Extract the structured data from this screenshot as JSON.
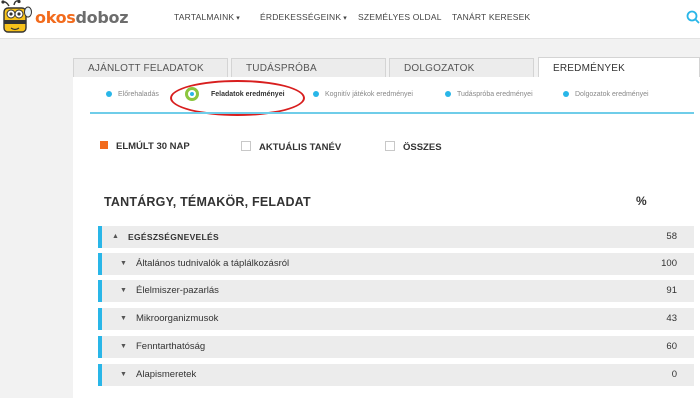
{
  "brand": {
    "logo_part1": "okos",
    "logo_part2": "doboz"
  },
  "nav": {
    "items": [
      {
        "label": "TARTALMAINK",
        "dropdown": true
      },
      {
        "label": "ÉRDEKESSÉGEINK",
        "dropdown": true
      },
      {
        "label": "SZEMÉLYES OLDAL",
        "dropdown": false
      },
      {
        "label": "TANÁRT KERESEK",
        "dropdown": false
      }
    ],
    "caret": "▾",
    "search_icon": "search-icon"
  },
  "tabs": [
    {
      "label": "AJÁNLOTT FELADATOK",
      "active": false
    },
    {
      "label": "TUDÁSPRÓBA",
      "active": false
    },
    {
      "label": "DOLGOZATOK",
      "active": false
    },
    {
      "label": "EREDMÉNYEK",
      "active": true
    }
  ],
  "subtabs": [
    {
      "label": "Előrehaladás",
      "active": false
    },
    {
      "label": "Feladatok eredményei",
      "active": true
    },
    {
      "label": "Kognitív játékok eredményei",
      "active": false
    },
    {
      "label": "Tudáspróba eredményei",
      "active": false
    },
    {
      "label": "Dolgozatok eredményei",
      "active": false
    }
  ],
  "filters": [
    {
      "label": "ELMÚLT 30 NAP",
      "checked": true
    },
    {
      "label": "AKTUÁLIS TANÉV",
      "checked": false
    },
    {
      "label": "ÖSSZES",
      "checked": false
    }
  ],
  "table": {
    "header_title": "TANTÁRGY, TÉMAKÖR, FELADAT",
    "header_pct": "%",
    "parent": {
      "name": "EGÉSZSÉGNEVELÉS",
      "value": "58",
      "arrow": "▲"
    },
    "rows": [
      {
        "name": "Általános tudnivalók a táplálkozásról",
        "value": "100",
        "arrow": "▼"
      },
      {
        "name": "Élelmiszer-pazarlás",
        "value": "91",
        "arrow": "▼"
      },
      {
        "name": "Mikroorganizmusok",
        "value": "43",
        "arrow": "▼"
      },
      {
        "name": "Fenntarthatóság",
        "value": "60",
        "arrow": "▼"
      },
      {
        "name": "Alapismeretek",
        "value": "0",
        "arrow": "▼"
      }
    ]
  },
  "colors": {
    "accent_orange": "#f26b1d",
    "accent_blue": "#29b6e8",
    "active_ring_green": "#8cc63f",
    "annotation_red": "#d81e1e"
  }
}
